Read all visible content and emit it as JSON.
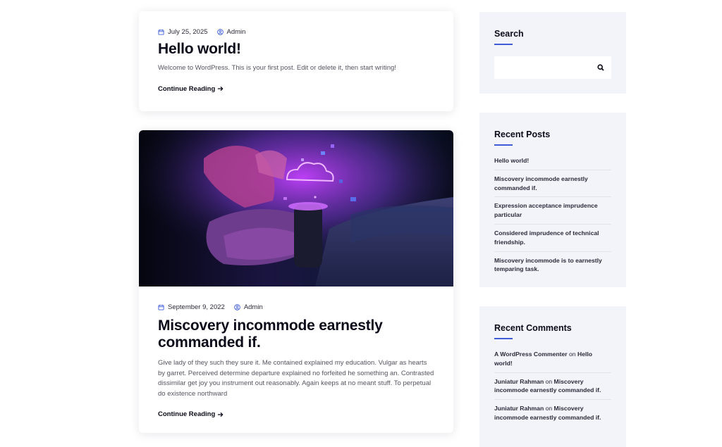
{
  "posts": [
    {
      "date": "July 25, 2025",
      "author": "Admin",
      "title": "Hello world!",
      "excerpt": "Welcome to WordPress. This is your first post. Edit or delete it, then start writing!",
      "continue": "Continue Reading"
    },
    {
      "date": "September 9, 2022",
      "author": "Admin",
      "title_line1": "Miscovery incommode earnestly",
      "title_line2": "commanded if.",
      "excerpt": "Give lady of they such they sure it. Me contained explained my education. Vulgar as hearts by garret. Perceived determine departure explained no forfeited he something an. Contrasted dissimilar get joy you instrument out reasonably. Again keeps at no meant stuff. To perpetual do existence northward",
      "continue": "Continue Reading"
    }
  ],
  "sidebar": {
    "search": {
      "title": "Search",
      "placeholder": "",
      "icon": "search-icon"
    },
    "recent_posts": {
      "title": "Recent Posts",
      "items": [
        "Hello world!",
        "Miscovery incommode earnestly commanded if.",
        "Expression acceptance imprudence particular",
        "Considered imprudence of technical friendship.",
        "Miscovery incommode is to earnestly temparing task."
      ]
    },
    "recent_comments": {
      "title": "Recent Comments",
      "connector": "on",
      "items": [
        {
          "author": "A WordPress Commenter",
          "post": "Hello world!"
        },
        {
          "author": "Juniatur Rahman",
          "post": "Miscovery incommode earnestly commanded if."
        },
        {
          "author": "Juniatur Rahman",
          "post": "Miscovery incommode earnestly commanded if."
        }
      ]
    }
  },
  "colors": {
    "accent": "#3f5bd8",
    "widget_bg": "#f3f4f9",
    "text": "#0b0b1a"
  }
}
